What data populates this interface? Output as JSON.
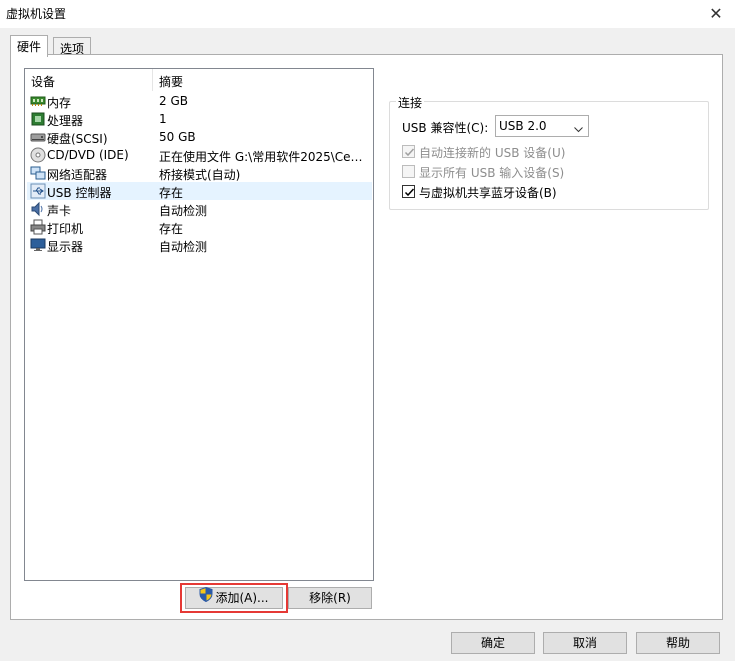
{
  "window": {
    "title": "虚拟机设置"
  },
  "tabs": [
    {
      "label": "硬件",
      "active": true
    },
    {
      "label": "选项",
      "active": false
    }
  ],
  "device_list": {
    "headers": {
      "device": "设备",
      "summary": "摘要"
    },
    "rows": [
      {
        "name": "内存",
        "summary": "2 GB",
        "icon": "memory-icon"
      },
      {
        "name": "处理器",
        "summary": "1",
        "icon": "processor-icon"
      },
      {
        "name": "硬盘(SCSI)",
        "summary": "50 GB",
        "icon": "hard-disk-icon"
      },
      {
        "name": "CD/DVD (IDE)",
        "summary": "正在使用文件 G:\\常用软件2025\\Cen...",
        "icon": "cd-dvd-icon"
      },
      {
        "name": "网络适配器",
        "summary": "桥接模式(自动)",
        "icon": "network-adapter-icon"
      },
      {
        "name": "USB 控制器",
        "summary": "存在",
        "icon": "usb-icon",
        "selected": true
      },
      {
        "name": "声卡",
        "summary": "自动检测",
        "icon": "sound-card-icon"
      },
      {
        "name": "打印机",
        "summary": "存在",
        "icon": "printer-icon"
      },
      {
        "name": "显示器",
        "summary": "自动检测",
        "icon": "display-icon"
      }
    ]
  },
  "connection": {
    "group_label": "连接",
    "usb_compat_label": "USB 兼容性(C):",
    "usb_compat_value": "USB 2.0",
    "checkboxes": [
      {
        "label": "自动连接新的 USB 设备(U)",
        "checked": true,
        "disabled": true
      },
      {
        "label": "显示所有 USB 输入设备(S)",
        "checked": false,
        "disabled": true
      },
      {
        "label": "与虚拟机共享蓝牙设备(B)",
        "checked": true,
        "disabled": false
      }
    ]
  },
  "buttons": {
    "add": "添加(A)...",
    "remove": "移除(R)",
    "ok": "确定",
    "cancel": "取消",
    "help": "帮助"
  },
  "colors": {
    "selected_row": "#e5f3ff",
    "highlight": "#e53935"
  }
}
